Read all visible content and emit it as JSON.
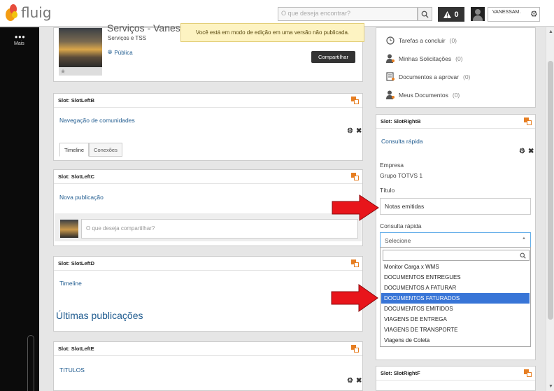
{
  "topbar": {
    "brand": "fluig",
    "search_placeholder": "O que deseja encontrar?",
    "alert_count": "0",
    "user_name": "VANESSAM."
  },
  "sidebar": {
    "more_label": "Mais"
  },
  "community": {
    "title_partial": "Serviços - Vanes",
    "subtitle": "Serviços e TSS",
    "visibility": "Pública",
    "share_label": "Compartilhar",
    "edit_banner": "Você está em modo de edição em uma versão não publicada."
  },
  "tasks": {
    "items": [
      {
        "label": "Tarefas a concluir",
        "count": "(0)"
      },
      {
        "label": "Minhas Solicitações",
        "count": "(0)"
      },
      {
        "label": "Documentos a aprovar",
        "count": "(0)"
      },
      {
        "label": "Meus Documentos",
        "count": "(0)"
      }
    ]
  },
  "slots": {
    "left_b": {
      "label": "Slot: SlotLeftB",
      "widget": "Navegação de comunidades",
      "tabs": [
        "Timeline",
        "Conexões"
      ]
    },
    "left_c": {
      "label": "Slot: SlotLeftC",
      "widget": "Nova publicação",
      "share_placeholder": "O que deseja compartilhar?"
    },
    "left_d": {
      "label": "Slot: SlotLeftD",
      "widget": "Timeline",
      "heading": "Últimas publicações"
    },
    "left_e": {
      "label": "Slot: SlotLeftE",
      "widget": "TITULOS"
    },
    "right_b": {
      "label": "Slot: SlotRightB",
      "widget": "Consulta rápida",
      "company_label": "Empresa",
      "company_value": "Grupo TOTVS 1",
      "title_label": "Título",
      "title_value": "Notas emitidas",
      "query_label": "Consulta rápida",
      "select_value": "Selecione",
      "options": [
        "Monitor Carga x WMS",
        "DOCUMENTOS ENTREGUES",
        "DOCUMENTOS A FATURAR",
        "DOCUMENTOS FATURADOS",
        "DOCUMENTOS EMITIDOS",
        "VIAGENS DE ENTREGA",
        "VIAGENS DE TRANSPORTE",
        "Viagens de Coleta"
      ],
      "highlighted_option": "DOCUMENTOS FATURADOS"
    },
    "right_f": {
      "label": "Slot: SlotRightF"
    }
  },
  "colors": {
    "accent": "#1f5b8f",
    "arrow": "#e8151b",
    "highlight": "#3875d7",
    "banner": "#fdf3c2"
  }
}
